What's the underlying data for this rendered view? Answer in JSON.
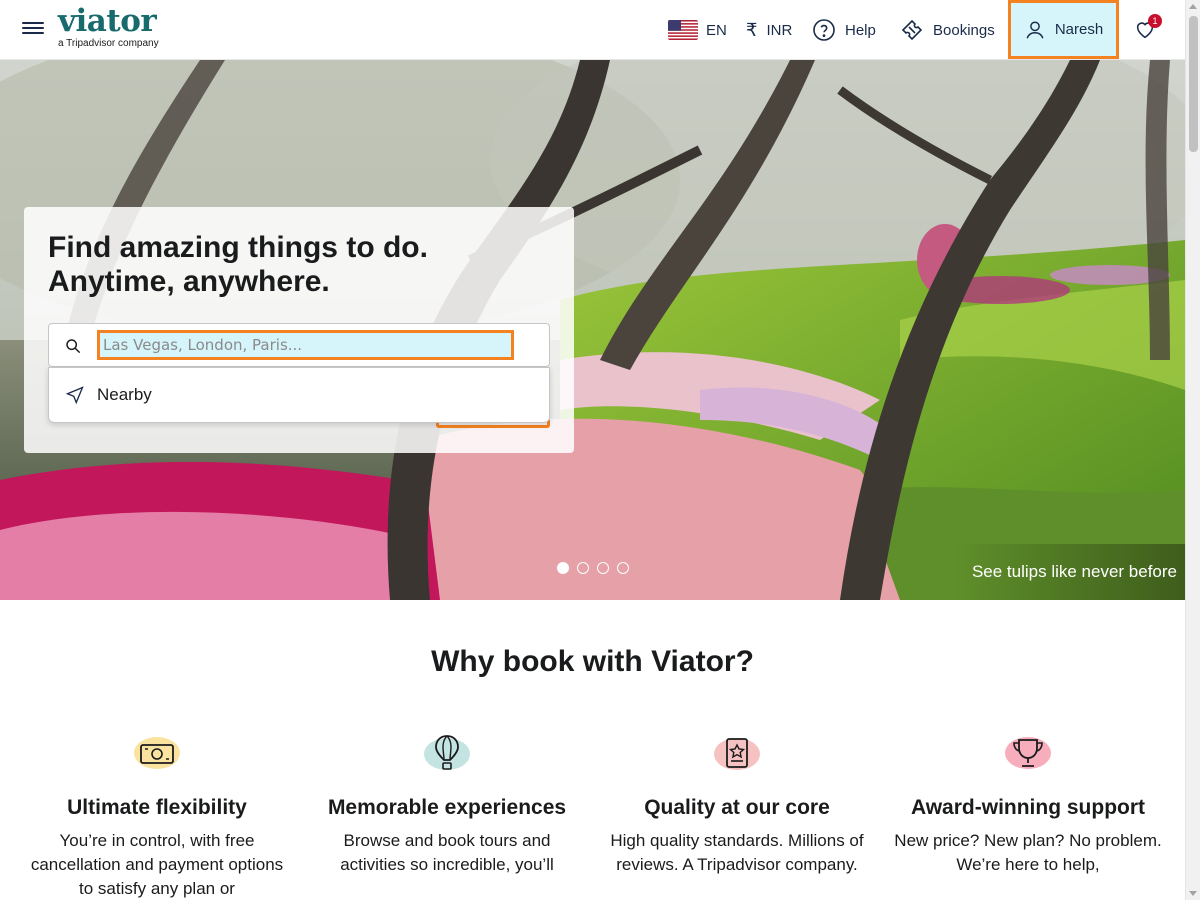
{
  "header": {
    "logo_text": "viator",
    "logo_sub": "a Tripadvisor company",
    "language": "EN",
    "currency_symbol": "₹",
    "currency": "INR",
    "help": "Help",
    "bookings": "Bookings",
    "user": "Naresh",
    "wishlist_count": "1"
  },
  "hero": {
    "headline_line1": "Find amazing things to do.",
    "headline_line2": "Anytime, anywhere.",
    "search_placeholder": "Las Vegas, London, Paris...",
    "dropdown_item": "Nearby",
    "caption": "See tulips like never before",
    "slides": 4,
    "active_slide": 1
  },
  "why": {
    "title": "Why book with Viator?",
    "features": [
      {
        "icon": "money-icon",
        "title": "Ultimate flexibility",
        "text": "You’re in control, with free cancellation and payment options to satisfy any plan or"
      },
      {
        "icon": "balloon-icon",
        "title": "Memorable experiences",
        "text": "Browse and book tours and activities so incredible, you’ll"
      },
      {
        "icon": "badge-star-icon",
        "title": "Quality at our core",
        "text": "High quality standards. Millions of reviews. A Tripadvisor company."
      },
      {
        "icon": "trophy-icon",
        "title": "Award-winning support",
        "text": "New price? New plan? No problem. We’re here to help,"
      }
    ]
  },
  "colors": {
    "brand": "#186b6d",
    "highlight_border": "#f58220",
    "highlight_fill": "#d6f5fb",
    "badge": "#c8102e"
  }
}
